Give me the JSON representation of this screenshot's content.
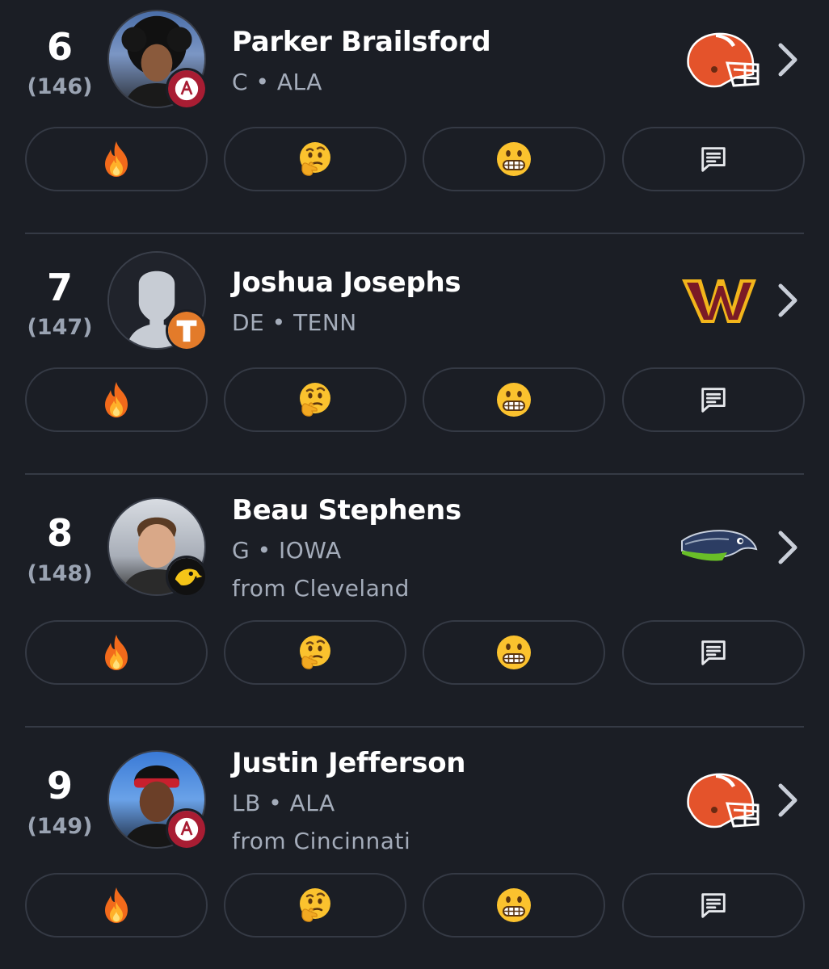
{
  "picks": [
    {
      "round_pick": "6",
      "overall": "(146)",
      "name": "Parker Brailsford",
      "position_school": "C • ALA",
      "from": "",
      "school_icon": "alabama-logo-icon",
      "team_icon": "browns-helmet-icon"
    },
    {
      "round_pick": "7",
      "overall": "(147)",
      "name": "Joshua Josephs",
      "position_school": "DE • TENN",
      "from": "",
      "school_icon": "tennessee-logo-icon",
      "team_icon": "commanders-logo-icon"
    },
    {
      "round_pick": "8",
      "overall": "(148)",
      "name": "Beau Stephens",
      "position_school": "G • IOWA",
      "from": "from Cleveland",
      "school_icon": "iowa-hawkeye-icon",
      "team_icon": "seahawks-logo-icon"
    },
    {
      "round_pick": "9",
      "overall": "(149)",
      "name": "Justin Jefferson",
      "position_school": "LB • ALA",
      "from": "from Cincinnati",
      "school_icon": "alabama-logo-icon",
      "team_icon": "browns-helmet-icon"
    }
  ],
  "reactions": [
    "fire-icon",
    "thinking-face-icon",
    "grimacing-face-icon",
    "comment-icon"
  ],
  "colors": {
    "background": "#1b1e25",
    "border": "#353a45",
    "muted_text": "#a4acba",
    "browns_orange": "#e4532b",
    "commanders_burgundy": "#7a1a26",
    "commanders_gold": "#f2b51b",
    "seahawks_navy": "#1d2e4f"
  }
}
